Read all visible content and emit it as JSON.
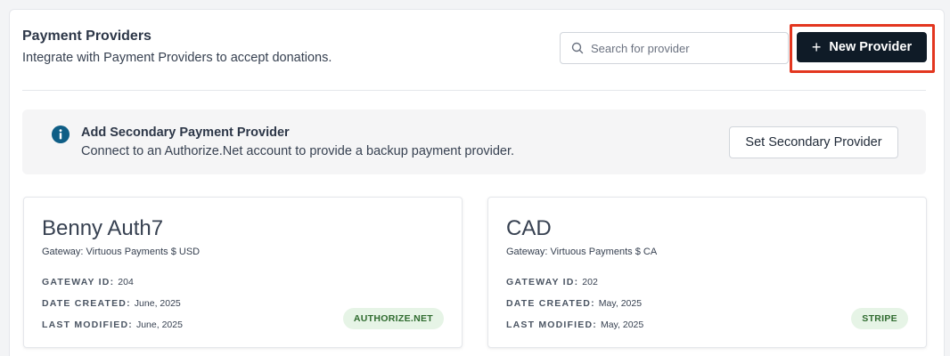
{
  "header": {
    "title": "Payment Providers",
    "subtitle": "Integrate with Payment Providers to accept donations."
  },
  "search": {
    "placeholder": "Search for provider",
    "icon": "search-icon"
  },
  "new_provider_button": {
    "icon": "+",
    "label": "New Provider"
  },
  "banner": {
    "icon": "info-icon",
    "title": "Add Secondary Payment Provider",
    "subtitle": "Connect to an Authorize.Net account to provide a backup payment provider.",
    "button_label": "Set Secondary Provider"
  },
  "labels": {
    "gateway_id": "GATEWAY ID:",
    "date_created": "DATE CREATED:",
    "last_modified": "LAST MODIFIED:"
  },
  "providers": [
    {
      "name": "Benny Auth7",
      "gateway": "Gateway: Virtuous Payments $ USD",
      "gateway_id": "204",
      "date_created": "June, 2025",
      "last_modified": "June, 2025",
      "badge": "AUTHORIZE.NET"
    },
    {
      "name": "CAD",
      "gateway": "Gateway: Virtuous Payments $ CA",
      "gateway_id": "202",
      "date_created": "May, 2025",
      "last_modified": "May, 2025",
      "badge": "STRIPE"
    }
  ],
  "colors": {
    "primary_button": "#0f1b27",
    "highlight_frame": "#e3361f",
    "info_icon": "#0f5e86",
    "badge_bg": "#e6f4e6",
    "badge_text": "#2f6b2f"
  }
}
